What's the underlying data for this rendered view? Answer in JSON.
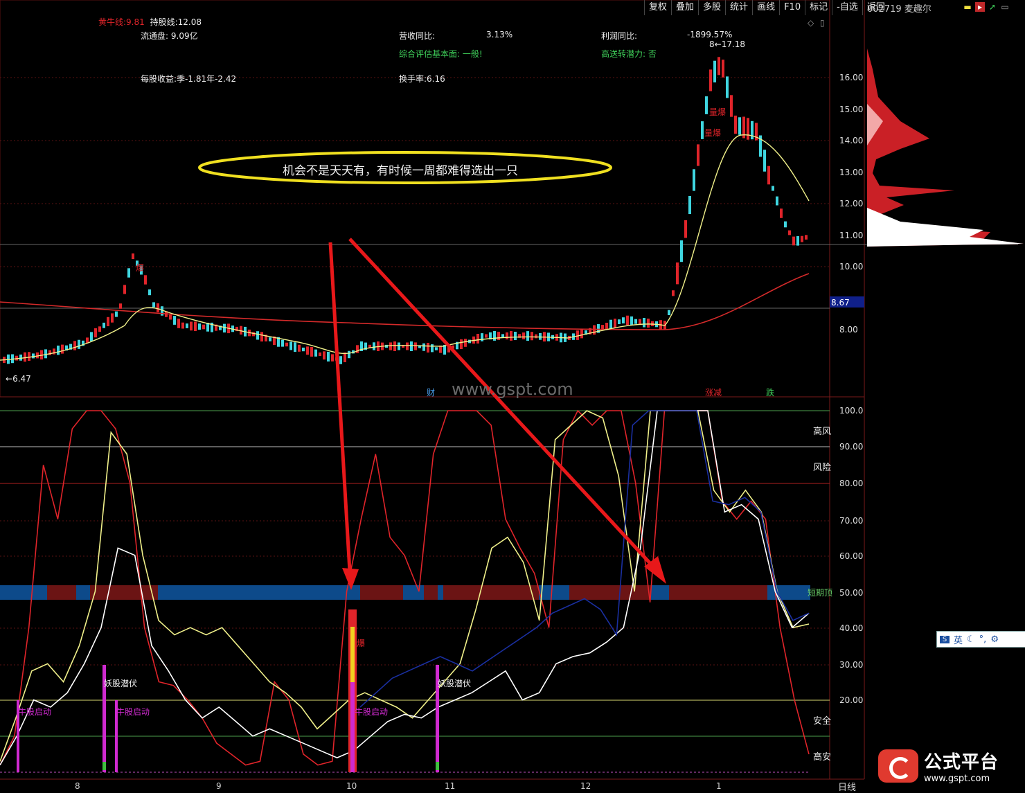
{
  "toolbar": {
    "items": [
      "复权",
      "叠加",
      "多股",
      "统计",
      "画线",
      "F10",
      "标记",
      "-自选",
      "返回"
    ]
  },
  "stock": {
    "code_name": "002719 麦趣尔"
  },
  "indicators": {
    "yellow_bull_label": "黄牛线:",
    "yellow_bull_value": "9.81",
    "hold_label": "持股线:",
    "hold_value": "12.08",
    "float_label": "流通盘:",
    "float_value": "9.09亿",
    "eps_label": "每股收益:",
    "eps_value": "季-1.81年-2.42",
    "revenue_yoy_label": "营收同比:",
    "revenue_yoy_value": "3.13%",
    "profit_yoy_label": "利润同比:",
    "profit_yoy_value": "-1899.57%",
    "fundamental_label": "综合评估基本面: 一般!",
    "transfer_label": "高送转潜力: 否",
    "turnover_label": "换手率:6.16"
  },
  "annotation": {
    "callout": "机会不是天天有，有时候一周都难得选出一只"
  },
  "price_axis": {
    "ticks": [
      "16.00",
      "15.00",
      "14.00",
      "13.00",
      "12.00",
      "11.00",
      "10.00",
      "8.00"
    ],
    "current": "8.67"
  },
  "price_labels": {
    "low": "6.47",
    "high": "17.18",
    "high_digit": "8"
  },
  "lower_axis": {
    "ticks": [
      "100.0",
      "90.00",
      "80.00",
      "70.00",
      "60.00",
      "50.00",
      "40.00",
      "30.00",
      "20.00"
    ]
  },
  "zones": {
    "high_risk": "高风",
    "risk": "风险",
    "short_term": "短期顶",
    "safe": "安全",
    "high_safe": "高安"
  },
  "signals": {
    "bull_start": "牛股启动",
    "demon_latent": "妖股潜伏",
    "burst": "爆",
    "big_burst": "量爆",
    "fin": "财",
    "limit": "涨减",
    "drop": "跌"
  },
  "months": [
    "8",
    "9",
    "10",
    "11",
    "12",
    "1"
  ],
  "period": "日线",
  "watermark": "www.gspt.com",
  "logo": {
    "title": "公式平台",
    "url": "www.gspt.com"
  },
  "ime": {
    "mode": "英"
  },
  "colors": {
    "up": "#e0242a",
    "down": "#3fd6e0",
    "ma_yellow": "#f0f08a",
    "ma_red": "#d42a2a",
    "band_blue": "#0d4a8a",
    "band_red": "#6b1414",
    "magenta": "#d02ad0"
  },
  "chart_data": {
    "type": "line",
    "price_ylim": [
      6.0,
      17.5
    ],
    "osc_ylim": [
      0,
      100
    ],
    "osc_series": [
      {
        "name": "",
        "color": "#e0242a",
        "values": [
          2,
          10,
          40,
          85,
          70,
          95,
          100,
          100,
          95,
          80,
          40,
          25,
          24,
          20,
          15,
          8,
          5,
          2,
          3,
          25,
          20,
          5,
          2,
          3,
          50,
          70,
          88,
          65,
          60,
          50,
          88,
          100,
          100,
          100,
          96,
          70,
          62,
          55,
          40,
          92,
          100,
          96,
          100,
          100,
          80,
          47,
          100,
          100,
          100,
          100,
          75,
          70,
          75,
          70,
          40,
          20,
          5
        ]
      },
      {
        "name": "",
        "color": "#f0f08a",
        "values": [
          3,
          15,
          28,
          30,
          25,
          35,
          50,
          94,
          88,
          60,
          42,
          38,
          40,
          38,
          40,
          35,
          30,
          25,
          22,
          18,
          12,
          16,
          20,
          22,
          20,
          18,
          15,
          20,
          25,
          30,
          45,
          62,
          65,
          58,
          42,
          92,
          96,
          100,
          98,
          82,
          50,
          100,
          100,
          100,
          100,
          78,
          72,
          78,
          72,
          50,
          40,
          41
        ]
      },
      {
        "name": "",
        "color": "#ffffff",
        "values": [
          2,
          10,
          20,
          18,
          22,
          30,
          40,
          62,
          60,
          35,
          28,
          20,
          15,
          18,
          14,
          10,
          12,
          10,
          8,
          6,
          4,
          6,
          10,
          14,
          16,
          15,
          18,
          20,
          22,
          25,
          28,
          20,
          22,
          30,
          32,
          33,
          36,
          40,
          62,
          100,
          100,
          100,
          100,
          72,
          74,
          70,
          50,
          40,
          44
        ]
      },
      {
        "name": "",
        "color": "#1a2fa0",
        "values": [
          18,
          22,
          26,
          28,
          30,
          32,
          30,
          28,
          31,
          34,
          37,
          40,
          44,
          46,
          48,
          45,
          38,
          96,
          100,
          100,
          100,
          100,
          75,
          74,
          76,
          72,
          50,
          42,
          44
        ]
      }
    ]
  }
}
